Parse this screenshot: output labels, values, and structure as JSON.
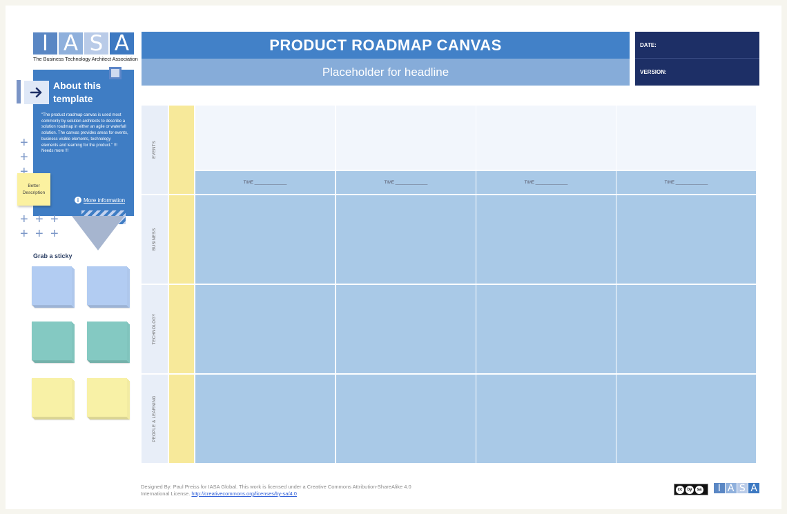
{
  "logo": {
    "letters": [
      "I",
      "A",
      "S",
      "A"
    ],
    "letter_colors": [
      "#5a87c4",
      "#8fb0dc",
      "#b9cbe8",
      "#3d79c2"
    ],
    "tagline": "The Business Technology Architect Association"
  },
  "about": {
    "title": "About this template",
    "text": "\"The product roadmap canvas is used most commonly by solution architects to describe a solution roadmap in either an agile or waterfall solution. The canvas provides areas for events, business visible elements, technology elements and learning for the product.\" !!! Needs more !!!",
    "more_info": "More information",
    "icons": {
      "arrow": "arrow-right-icon",
      "info": "info-icon"
    }
  },
  "sticky_note": {
    "text": "Better Description"
  },
  "grab_sticky": {
    "label": "Grab a sticky"
  },
  "sticky_pads": [
    {
      "color": "#b2ccf2"
    },
    {
      "color": "#b2ccf2"
    },
    {
      "color": "#84c9c2"
    },
    {
      "color": "#84c9c2"
    },
    {
      "color": "#f8f1a6"
    },
    {
      "color": "#f8f1a6"
    }
  ],
  "header": {
    "title": "PRODUCT ROADMAP CANVAS",
    "subtitle": "Placeholder for headline",
    "date_label": "DATE:",
    "version_label": "VERSION:"
  },
  "rows": [
    {
      "label": "EVENTS"
    },
    {
      "label": "BUSINESS"
    },
    {
      "label": "TECHNOLOGY"
    },
    {
      "label": "PEOPLE & LEARNING"
    }
  ],
  "time_labels": [
    "TIME ______________",
    "TIME ______________",
    "TIME ______________",
    "TIME ______________"
  ],
  "footer": {
    "text": "Designed By: Paul Preiss for IASA Global. This work is licensed under a Creative Commons Attribution-ShareAlike 4.0 International License.",
    "link": "http://creativecommons.org/licenses/by-sa/4.0",
    "cc_badge": [
      "cc",
      "by",
      "sa"
    ]
  },
  "colors": {
    "header_blue": "#4281c8",
    "subheader_blue": "#86acd9",
    "meta_navy": "#1d2f66",
    "cell_blue": "#a9c9e7",
    "lane_yellow": "#f7e99a"
  }
}
